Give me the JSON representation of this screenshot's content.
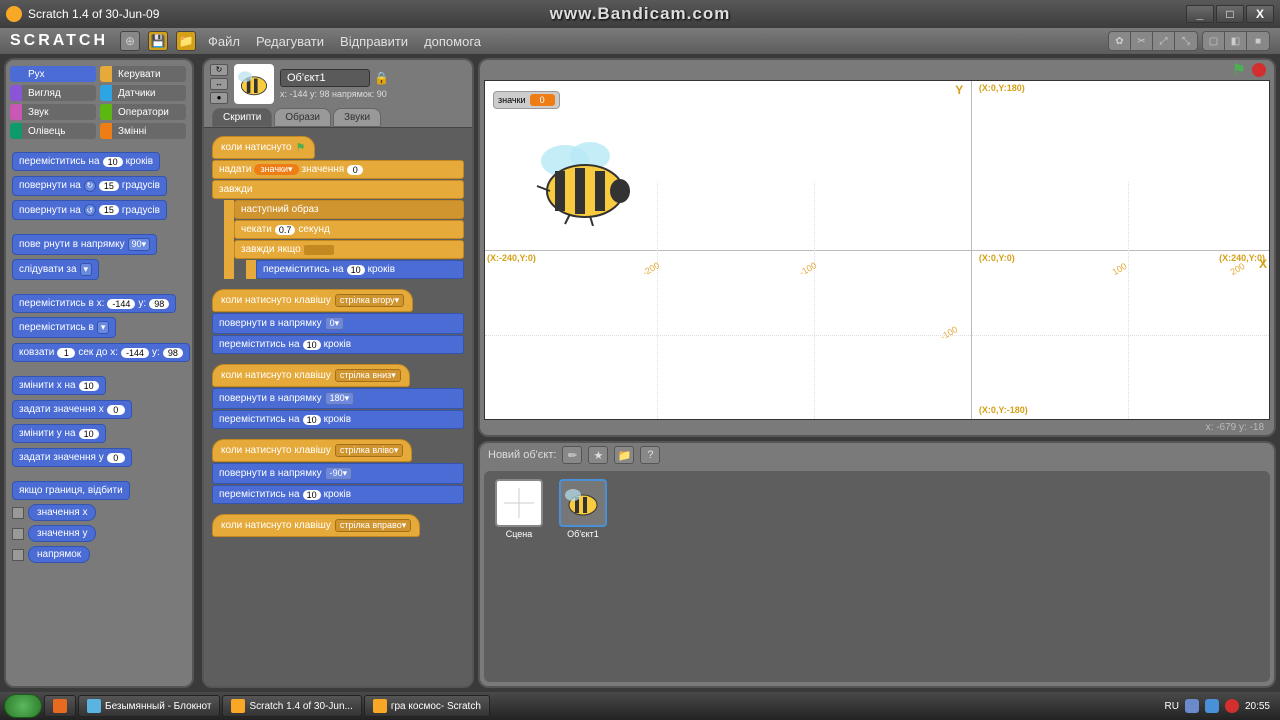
{
  "window": {
    "title": "Scratch 1.4 of 30-Jun-09"
  },
  "watermark": "www.Bandicam.com",
  "menus": {
    "file": "Файл",
    "edit": "Редагувати",
    "share": "Відправити",
    "help": "допомога"
  },
  "categories": [
    {
      "name": "Рух",
      "color": "#4a6cd4",
      "active": true
    },
    {
      "name": "Керувати",
      "color": "#e6aa3a"
    },
    {
      "name": "Вигляд",
      "color": "#8a55d7"
    },
    {
      "name": "Датчики",
      "color": "#2ca5e2"
    },
    {
      "name": "Звук",
      "color": "#c857b5"
    },
    {
      "name": "Оператори",
      "color": "#5cb712"
    },
    {
      "name": "Олівець",
      "color": "#0e9a6c"
    },
    {
      "name": "Змінні",
      "color": "#ee7d16"
    }
  ],
  "palette": {
    "move": {
      "t1": "переміститись на",
      "v": "10",
      "t2": "кроків"
    },
    "turnR": {
      "t1": "повернути на",
      "v": "15",
      "t2": "градусів"
    },
    "turnL": {
      "t1": "повернути на",
      "v": "15",
      "t2": "градусів"
    },
    "point": {
      "t1": "пове",
      "t1b": "рнути в напрямку",
      "v": "90▾"
    },
    "follow": {
      "t1": "слідувати за",
      "v": "▾"
    },
    "gotoXY": {
      "t1": "переміститись в x:",
      "x": "-144",
      "t2": "y:",
      "y": "98"
    },
    "gotoS": {
      "t1": "переміститись в",
      "v": "▾"
    },
    "glide": {
      "t1": "ковзати",
      "s": "1",
      "t2": "сек до x:",
      "x": "-144",
      "t3": "y:",
      "y": "98"
    },
    "changeX": {
      "t1": "змінити x на",
      "v": "10"
    },
    "setX": {
      "t1": "задати значення x",
      "v": "0"
    },
    "changeY": {
      "t1": "змінити y на",
      "v": "10"
    },
    "setY": {
      "t1": "задати значення y",
      "v": "0"
    },
    "bounce": "якщо границя, відбити",
    "rep": {
      "x": "значення x",
      "y": "значення y",
      "dir": "напрямок"
    }
  },
  "sprite": {
    "name": "Об'єкт1",
    "coords": "x: -144 y: 98   напрямок: 90"
  },
  "tabs": {
    "scripts": "Скрипти",
    "costumes": "Образи",
    "sounds": "Звуки"
  },
  "scripts": {
    "s1": {
      "hat": "коли натиснуто",
      "setvar": {
        "t1": "надати",
        "var": "значки▾",
        "t2": "значення",
        "v": "0"
      },
      "forever": "завжди",
      "nextc": "наступний образ",
      "wait": {
        "t1": "чекати",
        "v": "0.7",
        "t2": "секунд"
      },
      "fif": "завжди якщо",
      "move": {
        "t1": "переміститись на",
        "v": "10",
        "t2": "кроків"
      }
    },
    "s2": {
      "hat": "коли натиснуто клавішу",
      "key": "стрілка вгору▾",
      "point": {
        "t1": "повернути в напрямку",
        "v": "0▾"
      },
      "move": {
        "t1": "переміститись на",
        "v": "10",
        "t2": "кроків"
      }
    },
    "s3": {
      "hat": "коли натиснуто клавішу",
      "key": "стрілка вниз▾",
      "point": {
        "t1": "повернути в напрямку",
        "v": "180▾"
      },
      "move": {
        "t1": "переміститись на",
        "v": "10",
        "t2": "кроків"
      }
    },
    "s4": {
      "hat": "коли натиснуто клавішу",
      "key": "стрілка вліво▾",
      "point": {
        "t1": "повернути в напрямку",
        "v": "-90▾"
      },
      "move": {
        "t1": "переміститись на",
        "v": "10",
        "t2": "кроків"
      }
    },
    "s5": {
      "hat": "коли натиснуто клавішу",
      "key": "стрілка вправо▾"
    }
  },
  "stage": {
    "varname": "значки",
    "varval": "0",
    "lbl_top": "(X:0,Y:180)",
    "lbl_left": "(X:-240,Y:0)",
    "lbl_center": "(X:0,Y:0)",
    "lbl_right": "(X:240,Y:0)",
    "lbl_bottom": "(X:0,Y:-180)",
    "Y": "Y",
    "X": "X",
    "t_n200": "-200",
    "t_n100": "-100",
    "t_100": "100",
    "t_200": "200",
    "t_vn100": "-100"
  },
  "mousecoords": "x: -679   y: -18",
  "newsprite": "Новий об'єкт:",
  "spritelist": {
    "sprite1": "Об'єкт1",
    "scene": "Сцена"
  },
  "taskbar": {
    "items": [
      "Безымянный - Блокнот",
      "Scratch 1.4 of 30-Jun...",
      "гра космос- Scratch"
    ],
    "lang": "RU",
    "time": "20:55"
  }
}
